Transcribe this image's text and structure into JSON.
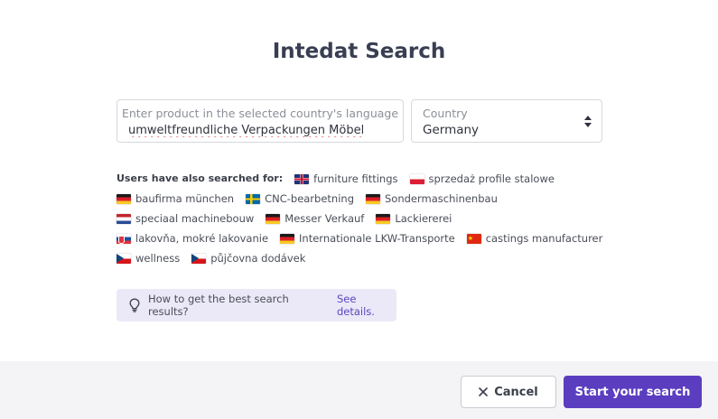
{
  "title": "Intedat Search",
  "product": {
    "placeholder": "Enter product in the selected country's language",
    "value": "umweltfreundliche Verpackungen Möbel"
  },
  "country": {
    "label": "Country",
    "value": "Germany"
  },
  "also_searched": {
    "label": "Users have also searched for:",
    "items": [
      {
        "flag": "gb",
        "text": "furniture fittings"
      },
      {
        "flag": "pl",
        "text": "sprzedaż profile stalowe"
      },
      {
        "flag": "de",
        "text": "baufirma münchen"
      },
      {
        "flag": "se",
        "text": "CNC-bearbetning"
      },
      {
        "flag": "de",
        "text": "Sondermaschinenbau"
      },
      {
        "flag": "nl",
        "text": "speciaal machinebouw"
      },
      {
        "flag": "de",
        "text": "Messer Verkauf"
      },
      {
        "flag": "de",
        "text": "Lackiererei"
      },
      {
        "flag": "sk",
        "text": "lakovňa, mokré lakovanie"
      },
      {
        "flag": "de",
        "text": "Internationale LKW-Transporte"
      },
      {
        "flag": "cn",
        "text": "castings manufacturer"
      },
      {
        "flag": "cz",
        "text": "wellness"
      },
      {
        "flag": "cz",
        "text": "půjčovna dodávek"
      }
    ]
  },
  "tip": {
    "text": "How to get the best search results?",
    "link": "See details."
  },
  "footer": {
    "cancel_label": "Cancel",
    "start_label": "Start your search"
  },
  "colors": {
    "accent": "#5b3dc0",
    "tip_bg": "#ebe8f7",
    "footer_bg": "#f4f4f6"
  },
  "icons": {
    "tip": "lightbulb-icon",
    "cancel": "close-icon",
    "select": "sort-arrows-icon"
  }
}
